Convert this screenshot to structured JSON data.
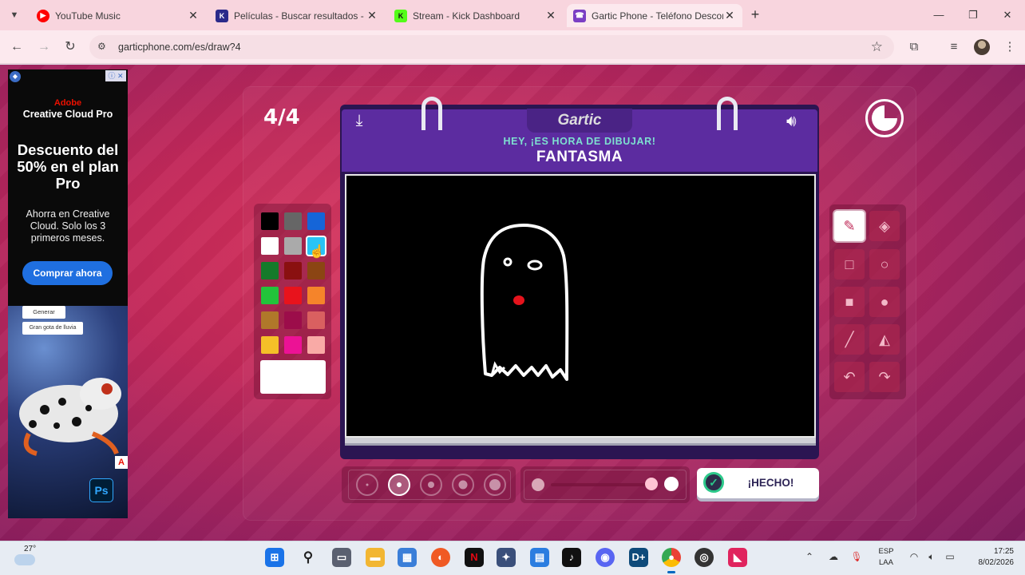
{
  "browser": {
    "tabs": [
      {
        "title": "YouTube Music",
        "icon": "youtube-music-icon",
        "color": "#ff0000"
      },
      {
        "title": "Películas - Buscar resultados - K",
        "icon": "k-icon",
        "color": "#2b2a8a"
      },
      {
        "title": "Stream - Kick Dashboard",
        "icon": "kick-icon",
        "color": "#53fc18"
      },
      {
        "title": "Gartic Phone - Teléfono Descon",
        "icon": "telephone-icon",
        "color": "#7b3fc4"
      }
    ],
    "url": "garticphone.com/es/draw?4"
  },
  "ad": {
    "brand_line1": "Adobe",
    "brand_line2": "Creative Cloud Pro",
    "headline": "Descuento del 50% en el plan Pro",
    "subtext": "Ahorra en Creative Cloud. Solo los 3 primeros meses.",
    "cta": "Comprar ahora",
    "generate_label": "Generar",
    "prompt_label": "Gran gota de lluvia",
    "ps_label": "Ps",
    "badge": "A"
  },
  "game": {
    "round_counter": "4/4",
    "logo": "Gartic",
    "prompt_title": "HEY, ¡ES HORA DE DIBUJAR!",
    "prompt_word": "FANTASMA",
    "done_label": "¡HECHO!",
    "timer_remaining_fraction": 0.75,
    "palette": [
      "#000000",
      "#666666",
      "#1565d8",
      "#ffffff",
      "#aaaaaa",
      "#29c4f5",
      "#157a2a",
      "#8a1010",
      "#8b4513",
      "#22c43a",
      "#e8131c",
      "#f5842a",
      "#b0782a",
      "#9c0d4a",
      "#d96060",
      "#f5c028",
      "#ec1295",
      "#f9aaa6"
    ],
    "selected_color": "#29c4f5",
    "current_color": "#ffffff",
    "brush_sizes": 5,
    "selected_brush_size": 2,
    "tools": [
      "pencil-icon",
      "eraser-icon",
      "rectangle-outline-icon",
      "circle-outline-icon",
      "rectangle-filled-icon",
      "circle-filled-icon",
      "line-icon",
      "fill-bucket-icon",
      "undo-icon",
      "redo-icon"
    ],
    "active_tool": "pencil-icon"
  },
  "taskbar": {
    "temperature": "27°",
    "language_line1": "ESP",
    "language_line2": "LAA",
    "time": "17:25",
    "date": "8/02/2026"
  }
}
